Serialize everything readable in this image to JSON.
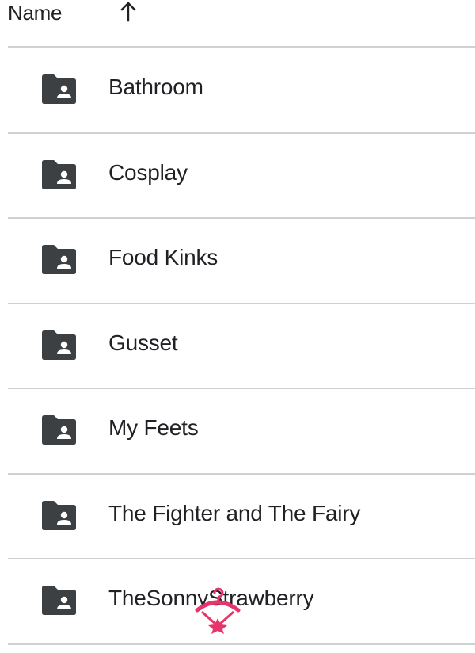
{
  "header": {
    "column_label": "Name",
    "sort_direction": "ascending",
    "sort_icon": "arrow-up-icon"
  },
  "rows": [
    {
      "label": "Bathroom",
      "icon": "shared-folder-icon"
    },
    {
      "label": "Cosplay",
      "icon": "shared-folder-icon"
    },
    {
      "label": "Food Kinks",
      "icon": "shared-folder-icon"
    },
    {
      "label": "Gusset",
      "icon": "shared-folder-icon"
    },
    {
      "label": "My Feets",
      "icon": "shared-folder-icon"
    },
    {
      "label": "The Fighter and The Fairy",
      "icon": "shared-folder-icon"
    },
    {
      "label": "TheSonnyStrawberry",
      "icon": "shared-folder-icon"
    }
  ],
  "colors": {
    "icon": "#3c4043",
    "text": "#202124",
    "divider": "#d0d0d0",
    "watermark": "#e8336b"
  },
  "watermark_icon": "hanger-logo-icon"
}
